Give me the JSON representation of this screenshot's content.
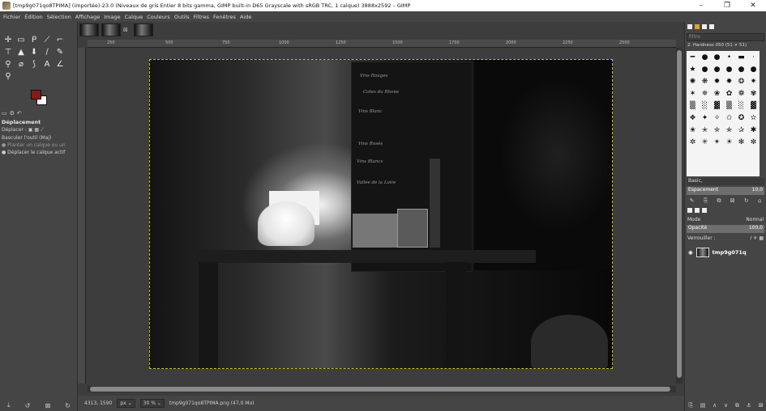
{
  "window": {
    "title": "[tmp9g071qo8TPIMA] (importée)-23.0 (Niveaux de gris Entier 8 bits gamma, GIMP built-in D65 Grayscale with sRGB TRC, 1 calque) 3888x2592 – GIMP",
    "minimize": "–",
    "maximize": "❐",
    "close": "✕"
  },
  "menu": [
    "Fichier",
    "Édition",
    "Sélection",
    "Affichage",
    "Image",
    "Calque",
    "Couleurs",
    "Outils",
    "Filtres",
    "Fenêtres",
    "Aide"
  ],
  "tool_options": {
    "title": "Déplacement",
    "move_label": "Déplacer :",
    "toggle_label": "Basculer l'outil (Maj)",
    "opt1": "Planter un calque ou un",
    "opt2": "Déplacer le calque actif"
  },
  "ruler": [
    "250",
    "500",
    "750",
    "1000",
    "1250",
    "1500",
    "1750",
    "2000",
    "2250",
    "2500",
    "2750",
    "3000",
    "3250",
    "3500",
    "3750"
  ],
  "board_text": [
    "Vins Rouges",
    "Cotes du Rhone",
    "Vins Blanc",
    "Vins Rosés",
    "Vins Blancs",
    "Vallée de la Loire"
  ],
  "status": {
    "coords": "4313, 1590",
    "unit": "px",
    "zoom": "30 %",
    "file": "tmp9g071qo8TPIMA.png (47,0 Mo)"
  },
  "brushes": {
    "filter_placeholder": "filtre",
    "brush_name": "2. Hardness 050 (51 × 51)",
    "preset": "Basic,",
    "spacing_label": "Espacement",
    "spacing_value": "10,0"
  },
  "layers": {
    "mode_label": "Mode",
    "mode_value": "Normal",
    "opacity_label": "Opacité",
    "opacity_value": "100,0",
    "lock_label": "Verrouiller :",
    "layer_name": "tmp9g071q"
  },
  "colors": {
    "fg": "#8a1a12",
    "bg": "#fafafa"
  }
}
